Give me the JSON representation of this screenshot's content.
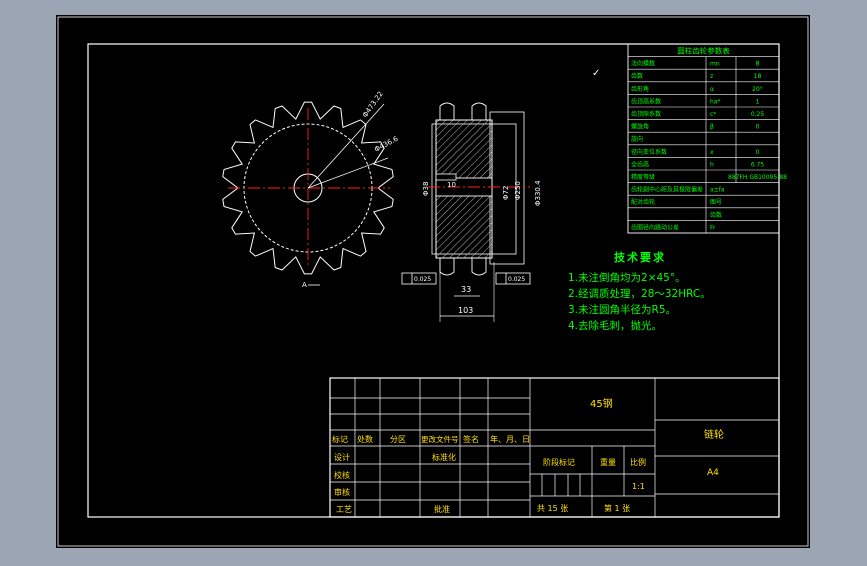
{
  "colors": {
    "outer_bg": "#9ba5b3",
    "canvas": "#000000",
    "line": "#ffffff",
    "green": "#00ff00",
    "red": "#ff2020",
    "hatch": "#c8c8c8"
  },
  "param_table": {
    "title": "圆柱齿轮参数表",
    "rows": [
      [
        "法向模数",
        "mn",
        "8"
      ],
      [
        "齿数",
        "z",
        "18"
      ],
      [
        "齿形角",
        "α",
        "20°"
      ],
      [
        "齿顶高系数",
        "ha*",
        "1"
      ],
      [
        "齿顶隙系数",
        "c*",
        "0.25"
      ],
      [
        "螺旋角",
        "β",
        "0"
      ],
      [
        "旋向",
        "",
        ""
      ],
      [
        "径向变位系数",
        "x",
        "0"
      ],
      [
        "全齿高",
        "h",
        "6.75"
      ],
      [
        "精度等级",
        "",
        "887FH GB10095-88"
      ],
      [
        "齿轮副中心距及其极限偏差",
        "a±fa",
        ""
      ],
      [
        "配对齿轮",
        "图号",
        ""
      ],
      [
        "",
        "齿数",
        ""
      ],
      [
        "齿圈径向跳动公差",
        "Fr",
        ""
      ]
    ]
  },
  "tech": {
    "title": "技术要求",
    "items": [
      "1.未注倒角均为2×45°。",
      "2.经调质处理，28～32HRC。",
      "3.未注圆角半径为R5。",
      "4.去除毛刺，抛光。"
    ]
  },
  "front_view": {
    "tooth_count": 18,
    "dim_a": "Φ473.22",
    "dim_b": "Φ436.6",
    "view_mark": "A"
  },
  "section_view": {
    "dim_d1": "Φ38",
    "dim_key": "10",
    "dim_d2": "Φ72",
    "dim_d3": "Φ250",
    "dim_d4": "Φ330.4",
    "dim_w1": "33",
    "dim_w2": "103",
    "tol_left": "0.025",
    "tol_right": "0.025"
  },
  "title_block": {
    "material": "45钢",
    "part_name": "链轮",
    "drawing_no": "A4",
    "rev_headers": [
      "标记",
      "处数",
      "分区",
      "更改文件号",
      "签名",
      "年、月、日"
    ],
    "design": "设计",
    "standardize": "标准化",
    "check": "校核",
    "review": "审核",
    "process": "工艺",
    "approve": "批准",
    "stage_label": "阶段标记",
    "weight_label": "重量",
    "scale_label": "比例",
    "scale_value": "1:1",
    "total_sheets": "共 15 张",
    "sheet_no": "第 1 张"
  },
  "checkmark": "✓"
}
